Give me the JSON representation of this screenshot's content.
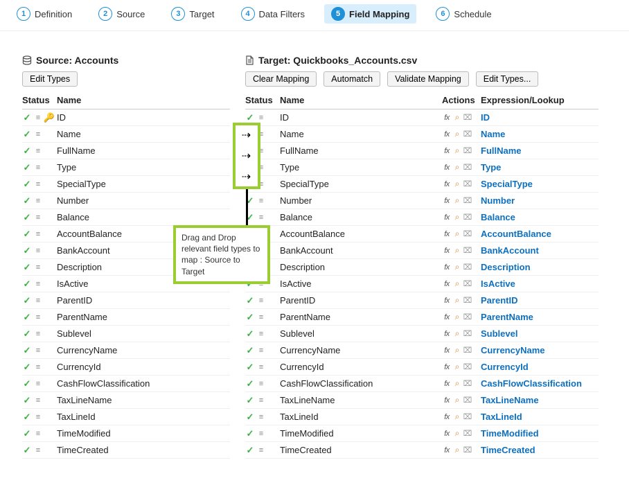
{
  "stepper": {
    "steps": [
      {
        "num": "1",
        "label": "Definition"
      },
      {
        "num": "2",
        "label": "Source"
      },
      {
        "num": "3",
        "label": "Target"
      },
      {
        "num": "4",
        "label": "Data Filters"
      },
      {
        "num": "5",
        "label": "Field Mapping"
      },
      {
        "num": "6",
        "label": "Schedule"
      }
    ],
    "active_index": 4
  },
  "source": {
    "title": "Source: Accounts",
    "buttons": {
      "edit_types": "Edit Types"
    },
    "headers": {
      "status": "Status",
      "name": "Name"
    },
    "rows": [
      {
        "name": "ID",
        "key": true
      },
      {
        "name": "Name"
      },
      {
        "name": "FullName"
      },
      {
        "name": "Type"
      },
      {
        "name": "SpecialType"
      },
      {
        "name": "Number"
      },
      {
        "name": "Balance"
      },
      {
        "name": "AccountBalance"
      },
      {
        "name": "BankAccount"
      },
      {
        "name": "Description"
      },
      {
        "name": "IsActive"
      },
      {
        "name": "ParentID"
      },
      {
        "name": "ParentName"
      },
      {
        "name": "Sublevel"
      },
      {
        "name": "CurrencyName"
      },
      {
        "name": "CurrencyId"
      },
      {
        "name": "CashFlowClassification"
      },
      {
        "name": "TaxLineName"
      },
      {
        "name": "TaxLineId"
      },
      {
        "name": "TimeModified"
      },
      {
        "name": "TimeCreated"
      }
    ]
  },
  "target": {
    "title": "Target: Quickbooks_Accounts.csv",
    "buttons": {
      "clear": "Clear Mapping",
      "automatch": "Automatch",
      "validate": "Validate Mapping",
      "edit_types": "Edit Types..."
    },
    "headers": {
      "status": "Status",
      "name": "Name",
      "actions": "Actions",
      "expr": "Expression/Lookup"
    },
    "rows": [
      {
        "name": "ID",
        "expr": "ID"
      },
      {
        "name": "Name",
        "expr": "Name"
      },
      {
        "name": "FullName",
        "expr": "FullName"
      },
      {
        "name": "Type",
        "expr": "Type"
      },
      {
        "name": "SpecialType",
        "expr": "SpecialType"
      },
      {
        "name": "Number",
        "expr": "Number"
      },
      {
        "name": "Balance",
        "expr": "Balance"
      },
      {
        "name": "AccountBalance",
        "expr": "AccountBalance"
      },
      {
        "name": "BankAccount",
        "expr": "BankAccount"
      },
      {
        "name": "Description",
        "expr": "Description"
      },
      {
        "name": "IsActive",
        "expr": "IsActive"
      },
      {
        "name": "ParentID",
        "expr": "ParentID"
      },
      {
        "name": "ParentName",
        "expr": "ParentName"
      },
      {
        "name": "Sublevel",
        "expr": "Sublevel"
      },
      {
        "name": "CurrencyName",
        "expr": "CurrencyName"
      },
      {
        "name": "CurrencyId",
        "expr": "CurrencyId"
      },
      {
        "name": "CashFlowClassification",
        "expr": "CashFlowClassification"
      },
      {
        "name": "TaxLineName",
        "expr": "TaxLineName"
      },
      {
        "name": "TaxLineId",
        "expr": "TaxLineId"
      },
      {
        "name": "TimeModified",
        "expr": "TimeModified"
      },
      {
        "name": "TimeCreated",
        "expr": "TimeCreated"
      }
    ]
  },
  "callout": {
    "text": "Drag and Drop relevant field types to map : Source to Target"
  },
  "glyphs": {
    "check": "✓",
    "list_box": "≡",
    "key": "⚷",
    "fx": "fx",
    "mag": "⌕",
    "del": "⌧",
    "arrow": "⇢"
  }
}
